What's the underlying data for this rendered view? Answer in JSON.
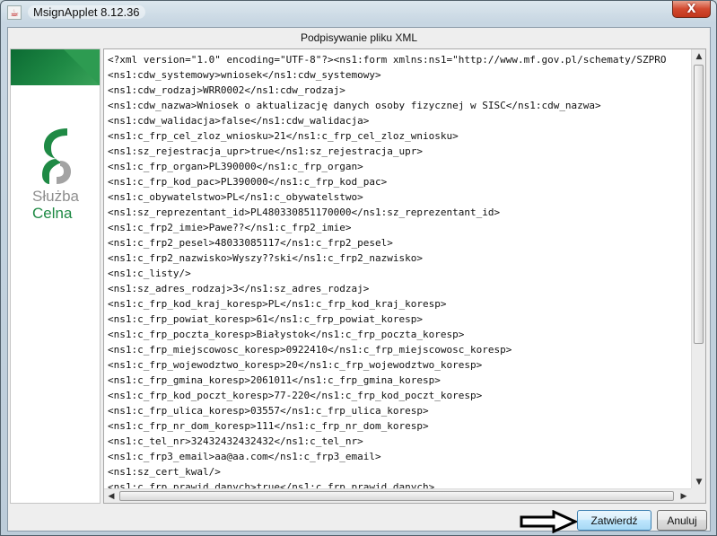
{
  "window": {
    "title": "MsignApplet 8.12.36",
    "close_symbol": "X"
  },
  "dialog": {
    "header": "Podpisywanie pliku XML"
  },
  "logo": {
    "line1": "Służba",
    "line2": "Celna",
    "colors": {
      "green": "#1f8a45",
      "gray": "#8f8f8f"
    }
  },
  "xml": {
    "lines": [
      "<?xml version=\"1.0\" encoding=\"UTF-8\"?><ns1:form xmlns:ns1=\"http://www.mf.gov.pl/schematy/SZPRO",
      "<ns1:cdw_systemowy>wniosek</ns1:cdw_systemowy>",
      "<ns1:cdw_rodzaj>WRR0002</ns1:cdw_rodzaj>",
      "<ns1:cdw_nazwa>Wniosek o aktualizację danych osoby fizycznej w SISC</ns1:cdw_nazwa>",
      "<ns1:cdw_walidacja>false</ns1:cdw_walidacja>",
      "<ns1:c_frp_cel_zloz_wniosku>21</ns1:c_frp_cel_zloz_wniosku>",
      "<ns1:sz_rejestracja_upr>true</ns1:sz_rejestracja_upr>",
      "<ns1:c_frp_organ>PL390000</ns1:c_frp_organ>",
      "<ns1:c_frp_kod_pac>PL390000</ns1:c_frp_kod_pac>",
      "<ns1:c_obywatelstwo>PL</ns1:c_obywatelstwo>",
      "<ns1:sz_reprezentant_id>PL480330851170000</ns1:sz_reprezentant_id>",
      "<ns1:c_frp2_imie>Pawe??</ns1:c_frp2_imie>",
      "<ns1:c_frp2_pesel>48033085117</ns1:c_frp2_pesel>",
      "<ns1:c_frp2_nazwisko>Wyszy??ski</ns1:c_frp2_nazwisko>",
      "<ns1:c_listy/>",
      "<ns1:sz_adres_rodzaj>3</ns1:sz_adres_rodzaj>",
      "<ns1:c_frp_kod_kraj_koresp>PL</ns1:c_frp_kod_kraj_koresp>",
      "<ns1:c_frp_powiat_koresp>61</ns1:c_frp_powiat_koresp>",
      "<ns1:c_frp_poczta_koresp>Białystok</ns1:c_frp_poczta_koresp>",
      "<ns1:c_frp_miejscowosc_koresp>0922410</ns1:c_frp_miejscowosc_koresp>",
      "<ns1:c_frp_wojewodztwo_koresp>20</ns1:c_frp_wojewodztwo_koresp>",
      "<ns1:c_frp_gmina_koresp>2061011</ns1:c_frp_gmina_koresp>",
      "<ns1:c_frp_kod_poczt_koresp>77-220</ns1:c_frp_kod_poczt_koresp>",
      "<ns1:c_frp_ulica_koresp>03557</ns1:c_frp_ulica_koresp>",
      "<ns1:c_frp_nr_dom_koresp>111</ns1:c_frp_nr_dom_koresp>",
      "<ns1:c_tel_nr>32432432432432</ns1:c_tel_nr>",
      "<ns1:c_frp3_email>aa@aa.com</ns1:c_frp3_email>",
      "<ns1:sz_cert_kwal/>",
      "<ns1:c_frp_prawid_danych>true</ns1:c_frp_prawid_danych>"
    ]
  },
  "scrollbars": {
    "vertical_position": 0,
    "horizontal_position": 0
  },
  "buttons": {
    "confirm_label": "Zatwierdź",
    "cancel_label": "Anuluj"
  },
  "icons": {
    "title": "java-icon",
    "annotation": "arrow-right-icon"
  }
}
